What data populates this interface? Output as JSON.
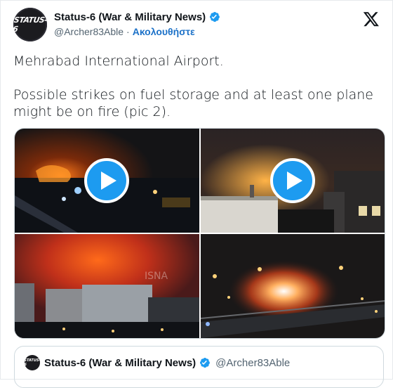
{
  "tweet": {
    "avatar_text": "STATUS-6",
    "display_name": "Status-6 (War & Military News)",
    "handle": "@Archer83Able",
    "separator": "·",
    "follow_label": "Ακολουθήστε",
    "paragraph_1": "Mehrabad International Airport.",
    "paragraph_2": "Possible strikes on fuel storage and at least one plane\nmight be on fire (pic 2).",
    "verified_icon": "verified-badge-icon",
    "brand_icon": "x-logo-icon"
  },
  "media": {
    "tiles": [
      {
        "name": "video-tile-1",
        "has_play": true,
        "icon": "play-icon"
      },
      {
        "name": "video-tile-2",
        "has_play": true,
        "icon": "play-icon"
      },
      {
        "name": "image-tile-3",
        "has_play": false,
        "watermark": "ISNA"
      },
      {
        "name": "image-tile-4",
        "has_play": false
      }
    ]
  },
  "quoted": {
    "display_name": "Status-6 (War & Military News)",
    "handle": "@Archer83Able",
    "avatar_text": "STATUS-6"
  },
  "colors": {
    "accent": "#1d9bf0",
    "link": "#1d72c8",
    "muted": "#536471",
    "border": "#cfd9de"
  }
}
